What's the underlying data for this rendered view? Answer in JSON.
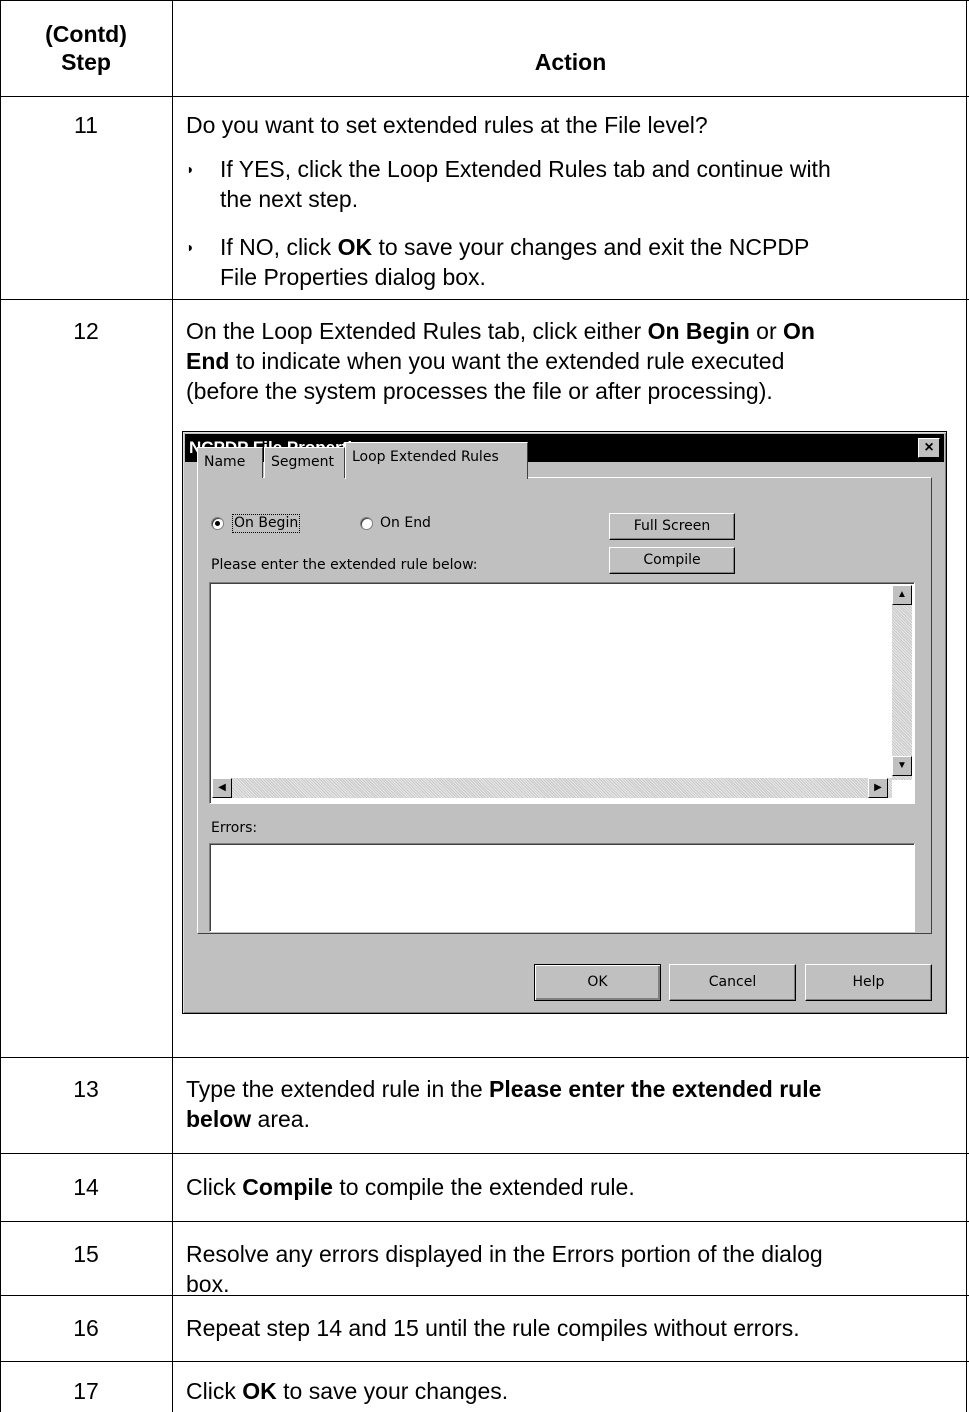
{
  "header": {
    "step_line1": "(Contd)",
    "step_line2": "Step",
    "action": "Action"
  },
  "rows": {
    "r11": {
      "step": "11",
      "question": "Do you want to set extended rules at the File level?",
      "yes_a": "If YES, click the Loop Extended Rules tab and continue with",
      "yes_b": "the next step.",
      "no_pre": "If NO, click ",
      "no_bold": "OK",
      "no_post": " to save your changes and exit the NCPDP",
      "no_b": "File Properties dialog box."
    },
    "r12": {
      "step": "12",
      "l1_pre": "On the Loop Extended Rules tab, click either ",
      "l1_bold1": "On Begin",
      "l1_mid": " or ",
      "l1_bold2": "On",
      "l2_bold": "End",
      "l2_post": " to indicate when you want the extended rule executed",
      "l3": "(before the system processes the file or after processing)."
    },
    "r13": {
      "step": "13",
      "pre": "Type the extended rule in the ",
      "bold1": "Please enter the extended rule",
      "bold2": "below",
      "post": " area."
    },
    "r14": {
      "step": "14",
      "pre": "Click ",
      "bold": "Compile",
      "post": " to compile the extended rule."
    },
    "r15": {
      "step": "15",
      "l1": "Resolve any errors displayed in the Errors portion of the dialog",
      "l2": "box."
    },
    "r16": {
      "step": "16",
      "text": "Repeat step 14 and 15 until the rule compiles without errors."
    },
    "r17": {
      "step": "17",
      "pre": "Click ",
      "bold": "OK",
      "post": " to save your changes."
    }
  },
  "dialog": {
    "title": "NCPDP File Properties",
    "close": "×",
    "tabs": [
      "Name",
      "Segment",
      "Loop Extended Rules"
    ],
    "radio_begin": "On Begin",
    "radio_end": "On End",
    "radio_selected": "On Begin",
    "full_screen": "Full Screen",
    "compile": "Compile",
    "rule_label": "Please enter the extended rule below:",
    "errors_label": "Errors:",
    "ok": "OK",
    "cancel": "Cancel",
    "help": "Help"
  }
}
